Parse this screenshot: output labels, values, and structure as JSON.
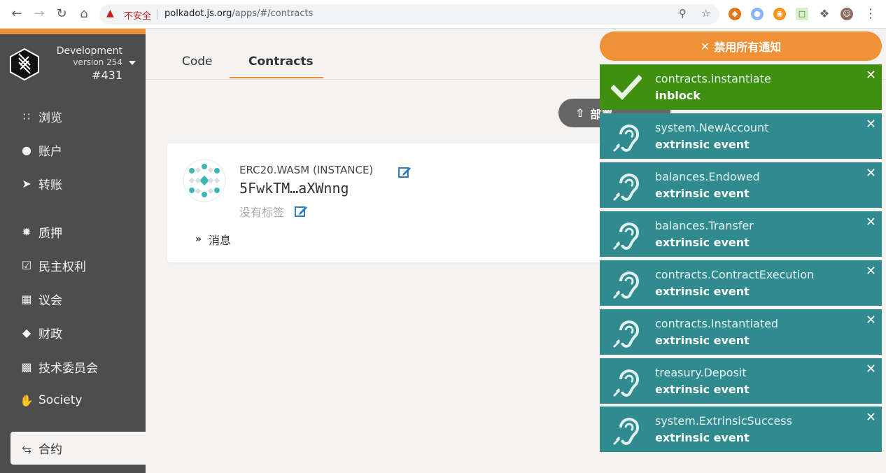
{
  "browser": {
    "insecure_label": "不安全",
    "url_host": "polkadot.js.org",
    "url_path": "/apps/#/contracts"
  },
  "sidebar": {
    "chain_name": "Development",
    "version": "version 254",
    "block": "#431",
    "items": [
      {
        "label": "浏览",
        "icon": "grid-icon"
      },
      {
        "label": "账户",
        "icon": "users-icon"
      },
      {
        "label": "转账",
        "icon": "paper-plane-icon"
      },
      {
        "label": "质押",
        "icon": "certificate-icon"
      },
      {
        "label": "民主权利",
        "icon": "calendar-check-icon"
      },
      {
        "label": "议会",
        "icon": "building-icon"
      },
      {
        "label": "财政",
        "icon": "gem-icon"
      },
      {
        "label": "技术委员会",
        "icon": "microchip-icon"
      },
      {
        "label": "Society",
        "icon": "hand-icon"
      }
    ],
    "active_item": {
      "label": "合约",
      "icon": "compress-icon"
    }
  },
  "tabs": [
    {
      "label": "Code"
    },
    {
      "label": "Contracts",
      "active": true
    }
  ],
  "toolbar": {
    "deploy_label": "部署"
  },
  "contract": {
    "name": "ERC20.WASM (INSTANCE)",
    "address": "5FwkTM…aXWnng",
    "tag_placeholder": "没有标签",
    "messages_label": "消息"
  },
  "notifications": {
    "disable_all_label": "禁用所有通知",
    "items": [
      {
        "title": "contracts.instantiate",
        "subtitle": "inblock",
        "status": "success"
      },
      {
        "title": "system.NewAccount",
        "subtitle": "extrinsic event",
        "status": "event"
      },
      {
        "title": "balances.Endowed",
        "subtitle": "extrinsic event",
        "status": "event"
      },
      {
        "title": "balances.Transfer",
        "subtitle": "extrinsic event",
        "status": "event"
      },
      {
        "title": "contracts.ContractExecution",
        "subtitle": "extrinsic event",
        "status": "event"
      },
      {
        "title": "contracts.Instantiated",
        "subtitle": "extrinsic event",
        "status": "event"
      },
      {
        "title": "treasury.Deposit",
        "subtitle": "extrinsic event",
        "status": "event"
      },
      {
        "title": "system.ExtrinsicSuccess",
        "subtitle": "extrinsic event",
        "status": "event"
      }
    ]
  },
  "colors": {
    "accent": "#f19135",
    "sidebar_bg": "#4d4d4d",
    "notif_event": "#2f8b8e",
    "notif_success": "#3f9011"
  }
}
